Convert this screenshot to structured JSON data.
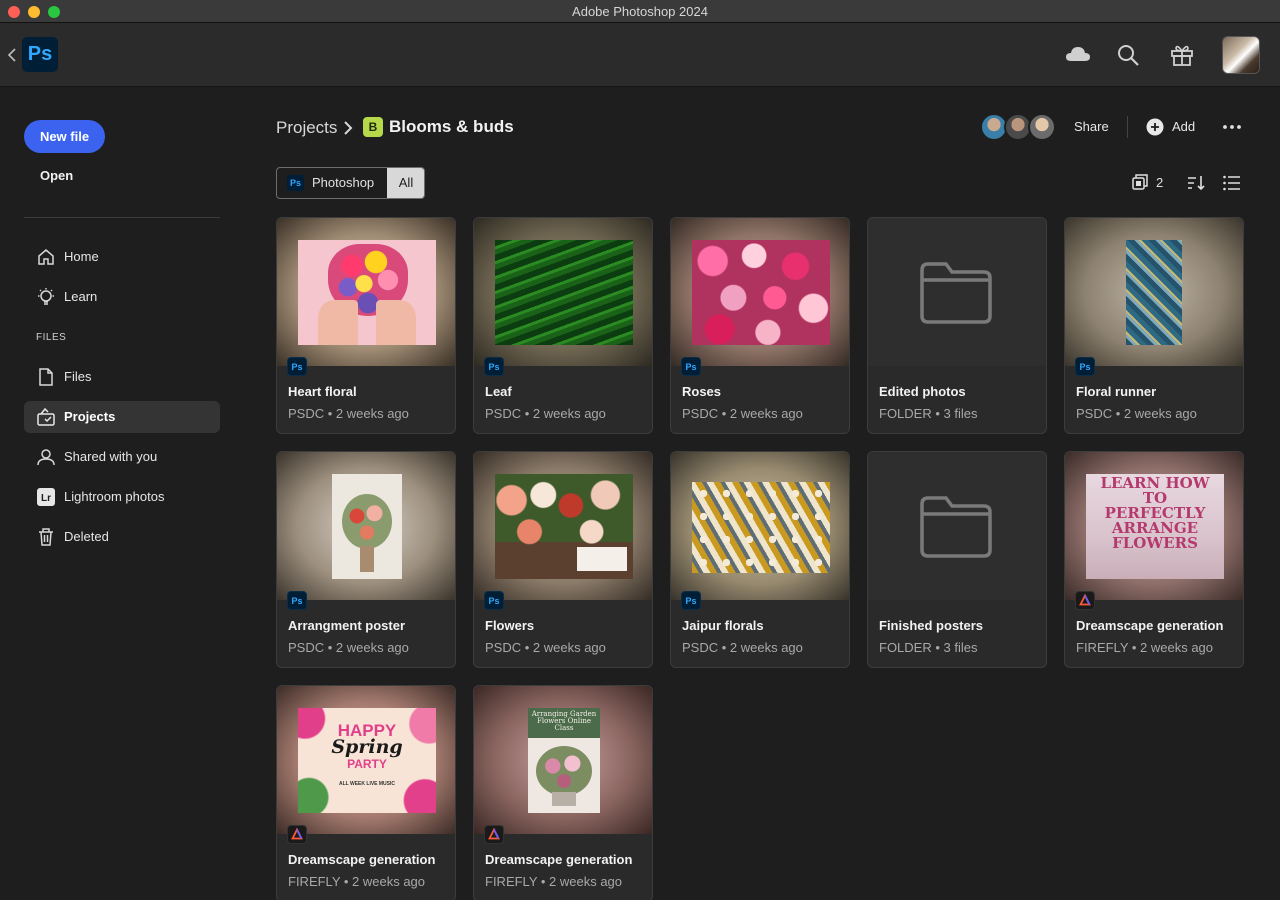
{
  "window": {
    "title": "Adobe Photoshop 2024"
  },
  "header": {
    "app_logo": "Ps",
    "icons": [
      "cloud-icon",
      "search-icon",
      "gift-icon"
    ]
  },
  "sidebar": {
    "new_file_label": "New file",
    "open_label": "Open",
    "nav": [
      {
        "label": "Home",
        "icon": "home-icon"
      },
      {
        "label": "Learn",
        "icon": "lightbulb-icon"
      }
    ],
    "files_heading": "FILES",
    "files_nav": [
      {
        "label": "Files",
        "icon": "document-icon",
        "active": false
      },
      {
        "label": "Projects",
        "icon": "projects-icon",
        "active": true
      },
      {
        "label": "Shared with you",
        "icon": "person-icon",
        "active": false
      },
      {
        "label": "Lightroom photos",
        "icon": "lightroom-icon",
        "active": false
      },
      {
        "label": "Deleted",
        "icon": "trash-icon",
        "active": false
      }
    ]
  },
  "breadcrumb": {
    "root": "Projects",
    "project_badge": "B",
    "project_name": "Blooms & buds"
  },
  "actions": {
    "share_label": "Share",
    "add_label": "Add"
  },
  "filter": {
    "app_badge": "Ps",
    "app_label": "Photoshop",
    "all_label": "All"
  },
  "view": {
    "count": "2"
  },
  "colors": {
    "accent": "#3c63f0",
    "project_badge": "#b5d94a",
    "ps_blue": "#31a8ff"
  },
  "cards": [
    {
      "name": "Heart floral",
      "meta": "PSDC • 2 weeks ago",
      "badge": "Ps"
    },
    {
      "name": "Leaf",
      "meta": "PSDC • 2 weeks ago",
      "badge": "Ps"
    },
    {
      "name": "Roses",
      "meta": "PSDC • 2 weeks ago",
      "badge": "Ps"
    },
    {
      "name": "Edited photos",
      "meta": "FOLDER • 3 files",
      "badge": ""
    },
    {
      "name": "Floral runner",
      "meta": "PSDC • 2 weeks ago",
      "badge": "Ps"
    },
    {
      "name": "Arrangment poster",
      "meta": "PSDC • 2 weeks ago",
      "badge": "Ps"
    },
    {
      "name": "Flowers",
      "meta": "PSDC • 2 weeks ago",
      "badge": "Ps"
    },
    {
      "name": "Jaipur florals",
      "meta": "PSDC • 2 weeks ago",
      "badge": "Ps"
    },
    {
      "name": "Finished posters",
      "meta": "FOLDER • 3 files",
      "badge": ""
    },
    {
      "name": "Dreamscape generation",
      "meta": "FIREFLY • 2 weeks ago",
      "badge": "firefly"
    },
    {
      "name": "Dreamscape generation",
      "meta": "FIREFLY • 2 weeks ago",
      "badge": "firefly"
    },
    {
      "name": "Dreamscape generation",
      "meta": "FIREFLY • 2 weeks ago",
      "badge": "firefly"
    }
  ],
  "posters": {
    "learn": "LEARN HOW TO PERFECTLY ARRANGE FLOWERS",
    "happy": "HAPPY",
    "spring": "Spring",
    "party": "PARTY",
    "music": "ALL WEEK LIVE MUSIC",
    "class_title": "Arranging Garden Flowers Online Class"
  }
}
